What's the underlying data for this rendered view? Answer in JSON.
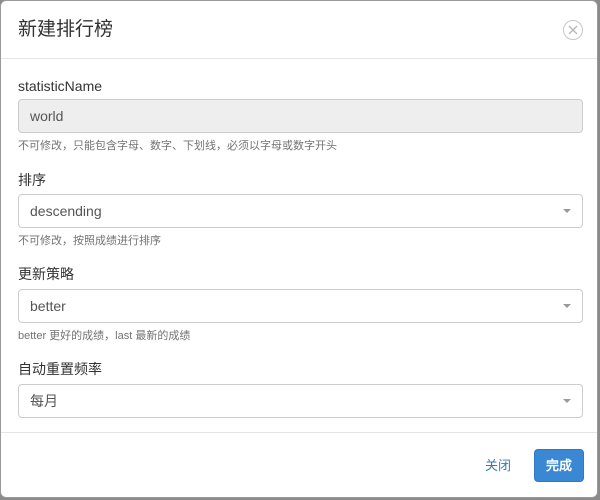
{
  "dialog": {
    "title": "新建排行榜",
    "close_icon": "close-circle-icon"
  },
  "fields": {
    "statistic_name": {
      "label": "statisticName",
      "value": "world",
      "help": "不可修改，只能包含字母、数字、下划线，必须以字母或数字开头"
    },
    "order": {
      "label": "排序",
      "value": "descending",
      "help": "不可修改，按照成绩进行排序"
    },
    "update_strategy": {
      "label": "更新策略",
      "value": "better",
      "help": "better 更好的成绩，last 最新的成绩"
    },
    "reset_frequency": {
      "label": "自动重置频率",
      "value": "每月"
    }
  },
  "footer": {
    "close_label": "关闭",
    "done_label": "完成"
  },
  "colors": {
    "primary": "#3a87d4",
    "link": "#337ab7"
  }
}
